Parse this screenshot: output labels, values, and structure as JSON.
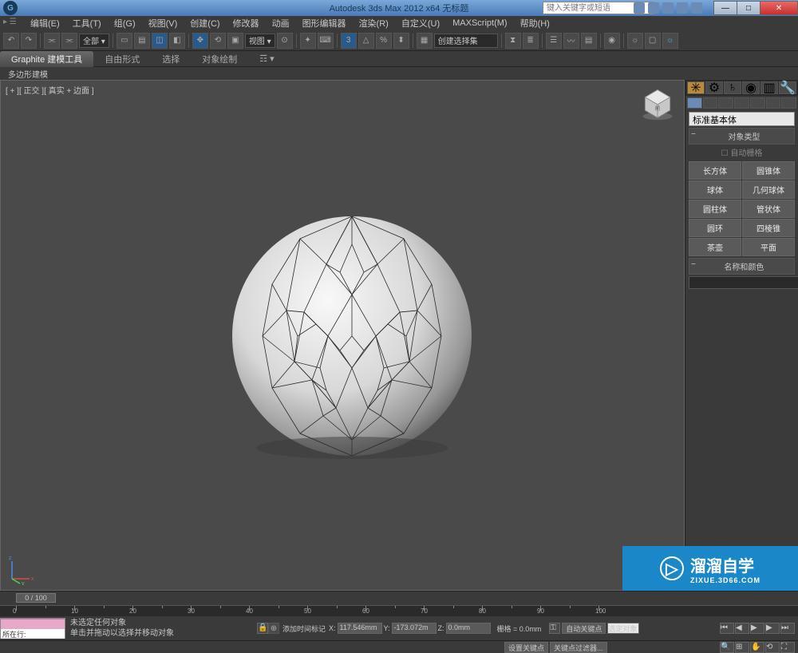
{
  "title": "Autodesk 3ds Max  2012 x64     无标题",
  "search_placeholder": "键入关键字或短语",
  "menu": [
    "编辑(E)",
    "工具(T)",
    "组(G)",
    "视图(V)",
    "创建(C)",
    "修改器",
    "动画",
    "图形编辑器",
    "渲染(R)",
    "自定义(U)",
    "MAXScript(M)",
    "帮助(H)"
  ],
  "toolbar": {
    "scope_dropdown": "全部 ▾",
    "view_dropdown": "视图  ▾",
    "selset_dropdown": "创建选择集"
  },
  "ribbon": {
    "tabs": [
      "Graphite 建模工具",
      "自由形式",
      "选择",
      "对象绘制"
    ],
    "sub": "多边形建模"
  },
  "viewport": {
    "label": "[ + ][ 正交 ][ 真实 + 边面 ]"
  },
  "cmd": {
    "category": "标准基本体",
    "rollout_objtype": "对象类型",
    "autogrid": "自动栅格",
    "objects": [
      "长方体",
      "圆锥体",
      "球体",
      "几何球体",
      "圆柱体",
      "管状体",
      "圆环",
      "四棱锥",
      "茶壶",
      "平面"
    ],
    "rollout_name": "名称和颜色"
  },
  "timeline": {
    "slider": "0 / 100"
  },
  "status": {
    "sel": "未选定任何对象",
    "hint": "单击并拖动以选择并移动对象",
    "x": "117.546mm",
    "y": "-173.072m",
    "z": "0.0mm",
    "grid": "栅格 = 0.0mm",
    "autokey": "自动关键点",
    "selset": "选定对象",
    "setkey": "设置关键点",
    "filter": "关键点过滤器...",
    "addtag": "添加时间标记",
    "row_label": "所在行:"
  },
  "watermark": {
    "brand": "溜溜自学",
    "url": "ZIXUE.3D66.COM"
  }
}
